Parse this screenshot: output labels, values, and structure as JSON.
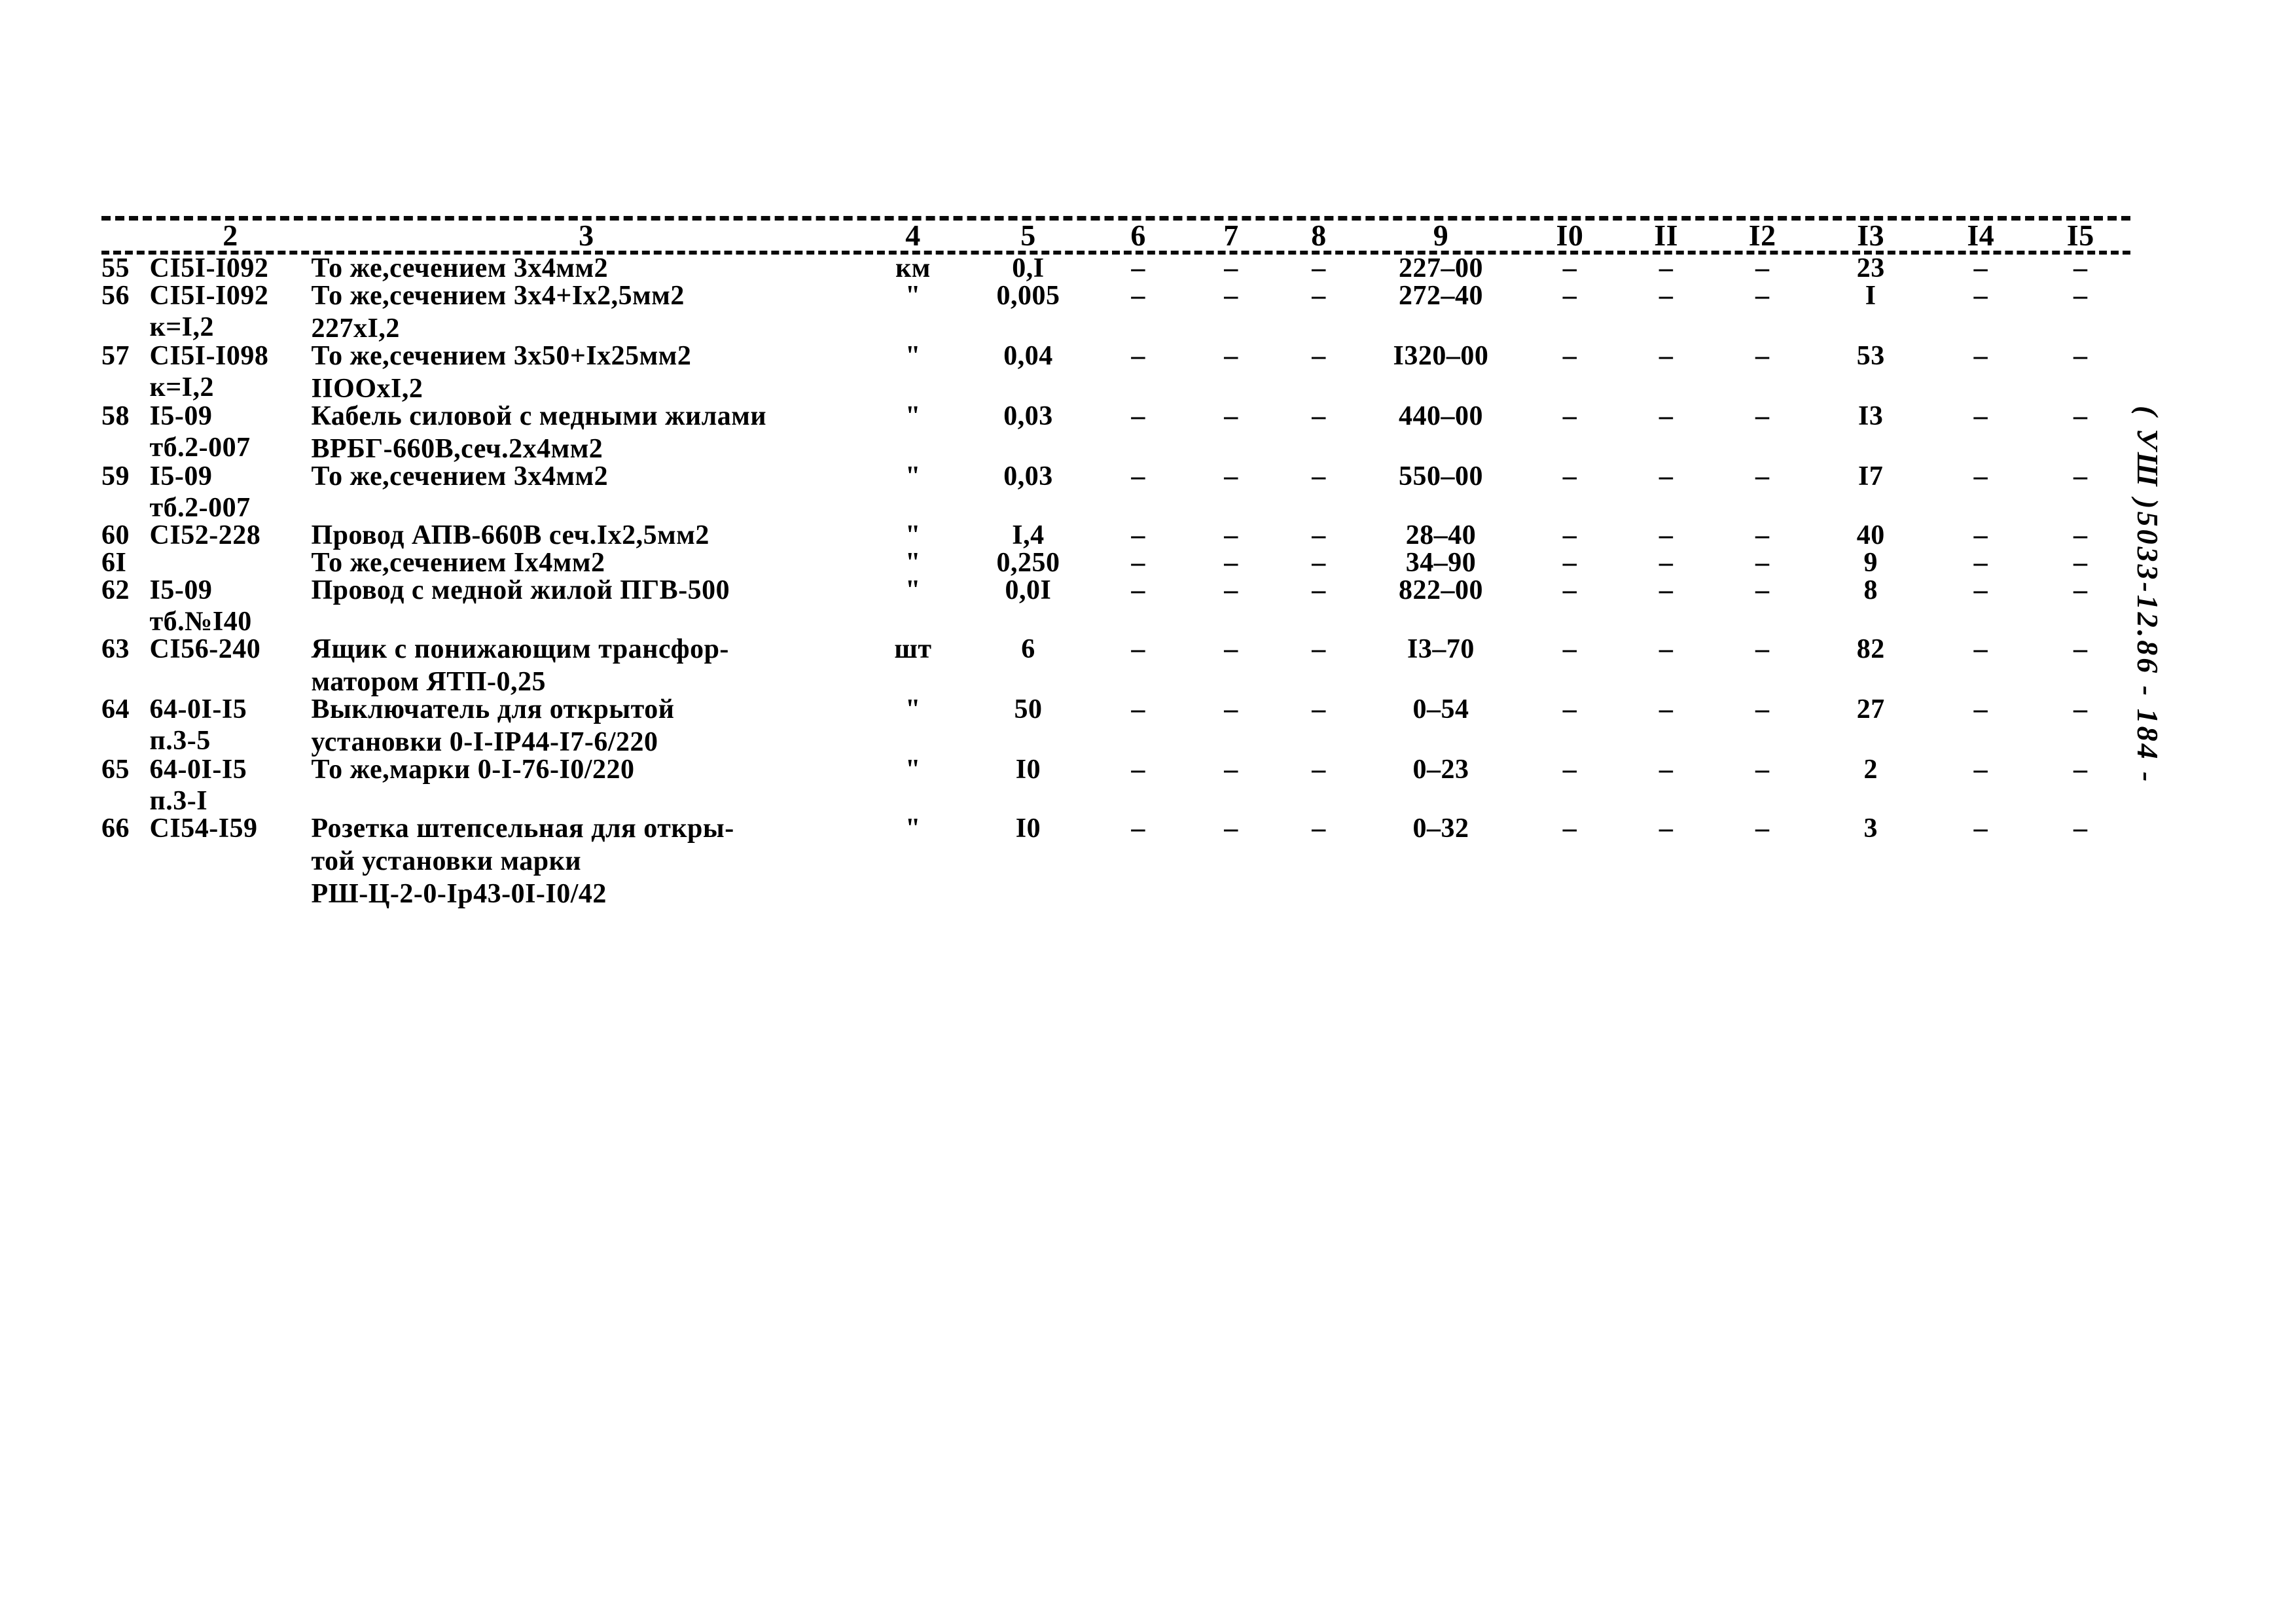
{
  "document": {
    "type": "normative-cost-table",
    "side_annotation": "( УШ )5033-12.86 - 184 -",
    "side_annotation_parts": {
      "prefix": "( УШ )",
      "code": "5033-12.86",
      "page": "- 184 -"
    }
  },
  "table": {
    "column_headers": [
      "2",
      "3",
      "4",
      "5",
      "6",
      "7",
      "8",
      "9",
      "I0",
      "II",
      "I2",
      "I3",
      "I4",
      "I5"
    ],
    "rows": [
      {
        "no": "55",
        "code": "СI5I-I092",
        "code_sub": "",
        "name": "То же,сечением 3х4мм2",
        "name_line2": "",
        "name_line3": "",
        "unit": "км",
        "c5": "0,I",
        "c6": "–",
        "c7": "–",
        "c8": "–",
        "c9": "227–00",
        "c10": "–",
        "c11": "–",
        "c12": "–",
        "c13": "23",
        "c14": "–",
        "c15": "–"
      },
      {
        "no": "56",
        "code": "СI5I-I092",
        "code_sub": "к=I,2",
        "name": "То же,сечением 3х4+Iх2,5мм2",
        "name_line2": "227хI,2",
        "name_line3": "",
        "unit": "\"",
        "c5": "0,005",
        "c6": "–",
        "c7": "–",
        "c8": "–",
        "c9": "272–40",
        "c10": "–",
        "c11": "–",
        "c12": "–",
        "c13": "I",
        "c14": "–",
        "c15": "–"
      },
      {
        "no": "57",
        "code": "СI5I-I098",
        "code_sub": "к=I,2",
        "name": "То же,сечением 3х50+Iх25мм2",
        "name_line2": "IIООхI,2",
        "name_line3": "",
        "unit": "\"",
        "c5": "0,04",
        "c6": "–",
        "c7": "–",
        "c8": "–",
        "c9": "I320–00",
        "c10": "–",
        "c11": "–",
        "c12": "–",
        "c13": "53",
        "c14": "–",
        "c15": "–"
      },
      {
        "no": "58",
        "code": "I5-09",
        "code_sub": "тб.2-007",
        "name": "Кабель силовой с медными жилами",
        "name_line2": "ВРБГ-660В,сеч.2х4мм2",
        "name_line3": "",
        "unit": "\"",
        "c5": "0,03",
        "c6": "–",
        "c7": "–",
        "c8": "–",
        "c9": "440–00",
        "c10": "–",
        "c11": "–",
        "c12": "–",
        "c13": "I3",
        "c14": "–",
        "c15": "–"
      },
      {
        "no": "59",
        "code": "I5-09",
        "code_sub": "тб.2-007",
        "name": "То же,сечением 3х4мм2",
        "name_line2": "",
        "name_line3": "",
        "unit": "\"",
        "c5": "0,03",
        "c6": "–",
        "c7": "–",
        "c8": "–",
        "c9": "550–00",
        "c10": "–",
        "c11": "–",
        "c12": "–",
        "c13": "I7",
        "c14": "–",
        "c15": "–"
      },
      {
        "no": "60",
        "code": "СI52-228",
        "code_sub": "",
        "name": "Провод АПВ-660В сеч.Iх2,5мм2",
        "name_line2": "",
        "name_line3": "",
        "unit": "\"",
        "c5": "I,4",
        "c6": "–",
        "c7": "–",
        "c8": "–",
        "c9": "28–40",
        "c10": "–",
        "c11": "–",
        "c12": "–",
        "c13": "40",
        "c14": "–",
        "c15": "–"
      },
      {
        "no": "6I",
        "code": "",
        "code_sub": "",
        "name": "То же,сечением Iх4мм2",
        "name_line2": "",
        "name_line3": "",
        "unit": "\"",
        "c5": "0,250",
        "c6": "–",
        "c7": "–",
        "c8": "–",
        "c9": "34–90",
        "c10": "–",
        "c11": "–",
        "c12": "–",
        "c13": "9",
        "c14": "–",
        "c15": "–"
      },
      {
        "no": "62",
        "code": "I5-09",
        "code_sub": "тб.№I40",
        "name": "Провод с медной жилой ПГВ-500",
        "name_line2": "",
        "name_line3": "",
        "unit": "\"",
        "c5": "0,0I",
        "c6": "–",
        "c7": "–",
        "c8": "–",
        "c9": "822–00",
        "c10": "–",
        "c11": "–",
        "c12": "–",
        "c13": "8",
        "c14": "–",
        "c15": "–"
      },
      {
        "no": "63",
        "code": "СI56-240",
        "code_sub": "",
        "name": "Ящик с понижающим трансфор-",
        "name_line2": "матором ЯТП-0,25",
        "name_line3": "",
        "unit": "шт",
        "c5": "6",
        "c6": "–",
        "c7": "–",
        "c8": "–",
        "c9": "I3–70",
        "c10": "–",
        "c11": "–",
        "c12": "–",
        "c13": "82",
        "c14": "–",
        "c15": "–"
      },
      {
        "no": "64",
        "code": "64-0I-I5",
        "code_sub": "п.3-5",
        "name": "Выключатель для открытой",
        "name_line2": "установки 0-I-IР44-I7-6/220",
        "name_line3": "",
        "unit": "\"",
        "c5": "50",
        "c6": "–",
        "c7": "–",
        "c8": "–",
        "c9": "0–54",
        "c10": "–",
        "c11": "–",
        "c12": "–",
        "c13": "27",
        "c14": "–",
        "c15": "–"
      },
      {
        "no": "65",
        "code": "64-0I-I5",
        "code_sub": "п.3-I",
        "name": "То же,марки 0-I-76-I0/220",
        "name_line2": "",
        "name_line3": "",
        "unit": "\"",
        "c5": "I0",
        "c6": "–",
        "c7": "–",
        "c8": "–",
        "c9": "0–23",
        "c10": "–",
        "c11": "–",
        "c12": "–",
        "c13": "2",
        "c14": "–",
        "c15": "–"
      },
      {
        "no": "66",
        "code": "СI54-I59",
        "code_sub": "",
        "name": "Розетка штепсельная для откры-",
        "name_line2": "той установки марки",
        "name_line3": "РШ-Ц-2-0-Iр43-0I-I0/42",
        "unit": "\"",
        "c5": "I0",
        "c6": "–",
        "c7": "–",
        "c8": "–",
        "c9": "0–32",
        "c10": "–",
        "c11": "–",
        "c12": "–",
        "c13": "3",
        "c14": "–",
        "c15": "–"
      }
    ]
  }
}
